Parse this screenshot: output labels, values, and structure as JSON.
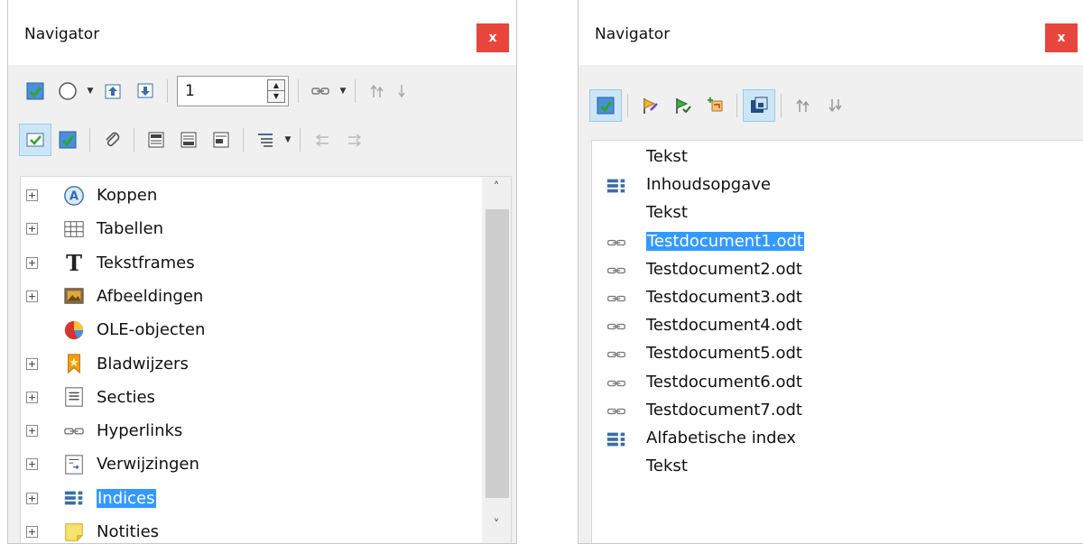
{
  "left": {
    "title": "Navigator",
    "page_number": "1",
    "tree": [
      {
        "label": "Koppen",
        "icon": "headings-icon",
        "expandable": true
      },
      {
        "label": "Tabellen",
        "icon": "table-icon",
        "expandable": true
      },
      {
        "label": "Tekstframes",
        "icon": "text-frame-icon",
        "expandable": true
      },
      {
        "label": "Afbeeldingen",
        "icon": "image-icon",
        "expandable": true
      },
      {
        "label": "OLE-objecten",
        "icon": "ole-object-icon",
        "expandable": false
      },
      {
        "label": "Bladwijzers",
        "icon": "bookmark-icon",
        "expandable": true
      },
      {
        "label": "Secties",
        "icon": "section-icon",
        "expandable": true
      },
      {
        "label": "Hyperlinks",
        "icon": "hyperlink-icon",
        "expandable": true
      },
      {
        "label": "Verwijzingen",
        "icon": "reference-icon",
        "expandable": true
      },
      {
        "label": "Indices",
        "icon": "index-icon",
        "expandable": true,
        "selected": true
      },
      {
        "label": "Notities",
        "icon": "comment-icon",
        "expandable": true
      }
    ]
  },
  "right": {
    "title": "Navigator",
    "tree": [
      {
        "label": "Tekst",
        "icon": ""
      },
      {
        "label": "Inhoudsopgave",
        "icon": "index-icon"
      },
      {
        "label": "Tekst",
        "icon": ""
      },
      {
        "label": "Testdocument1.odt",
        "icon": "link-icon",
        "selected": true
      },
      {
        "label": "Testdocument2.odt",
        "icon": "link-icon"
      },
      {
        "label": "Testdocument3.odt",
        "icon": "link-icon"
      },
      {
        "label": "Testdocument4.odt",
        "icon": "link-icon"
      },
      {
        "label": "Testdocument5.odt",
        "icon": "link-icon"
      },
      {
        "label": "Testdocument6.odt",
        "icon": "link-icon"
      },
      {
        "label": "Testdocument7.odt",
        "icon": "link-icon"
      },
      {
        "label": "Alfabetische index",
        "icon": "index-icon"
      },
      {
        "label": "Tekst",
        "icon": ""
      }
    ]
  },
  "colors": {
    "selection": "#3399ff",
    "close": "#e8453c",
    "active_tool": "#cde6f7"
  }
}
